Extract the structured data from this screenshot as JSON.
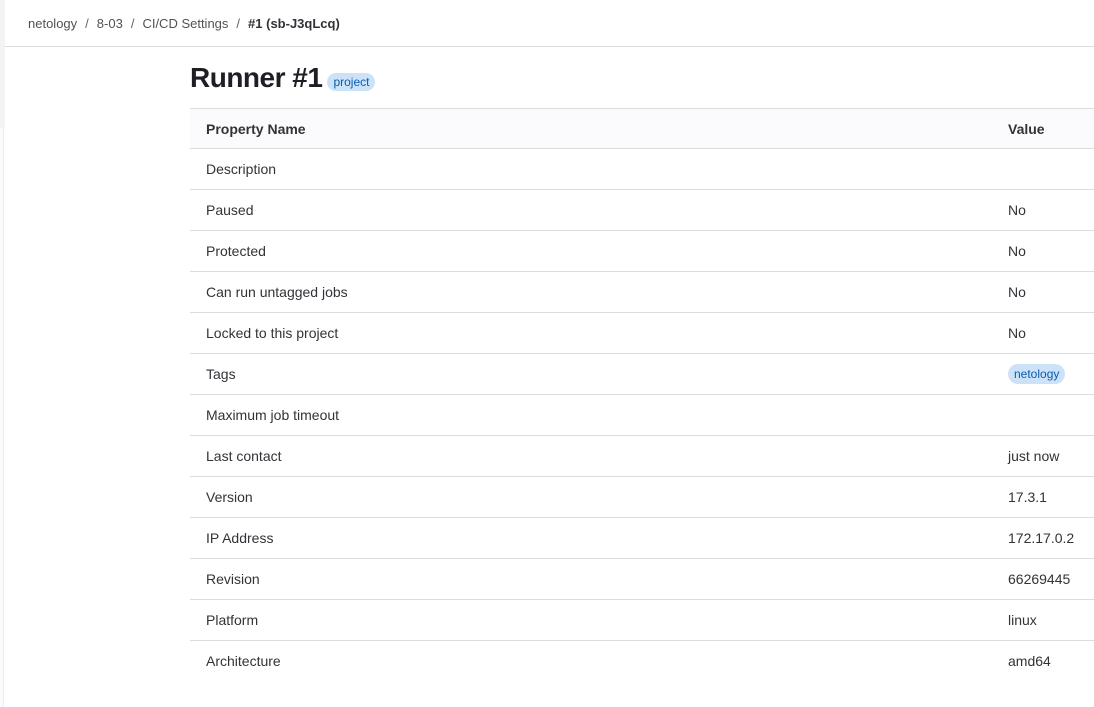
{
  "breadcrumb": {
    "items": [
      "netology",
      "8-03",
      "CI/CD Settings"
    ],
    "current": "#1 (sb-J3qLcq)",
    "separator": "/"
  },
  "page": {
    "title": "Runner #1",
    "badge": "project"
  },
  "table": {
    "headers": {
      "name": "Property Name",
      "value": "Value"
    },
    "rows": [
      {
        "name": "Description",
        "value": ""
      },
      {
        "name": "Paused",
        "value": "No"
      },
      {
        "name": "Protected",
        "value": "No"
      },
      {
        "name": "Can run untagged jobs",
        "value": "No"
      },
      {
        "name": "Locked to this project",
        "value": "No"
      },
      {
        "name": "Tags",
        "value": "netology",
        "is_tag": true
      },
      {
        "name": "Maximum job timeout",
        "value": ""
      },
      {
        "name": "Last contact",
        "value": "just now"
      },
      {
        "name": "Version",
        "value": "17.3.1"
      },
      {
        "name": "IP Address",
        "value": "172.17.0.2"
      },
      {
        "name": "Revision",
        "value": "66269445"
      },
      {
        "name": "Platform",
        "value": "linux"
      },
      {
        "name": "Architecture",
        "value": "amd64"
      }
    ]
  },
  "colors": {
    "badge_bg": "#cbe2f9",
    "badge_text": "#0b5cad",
    "border": "#dcdcde"
  }
}
